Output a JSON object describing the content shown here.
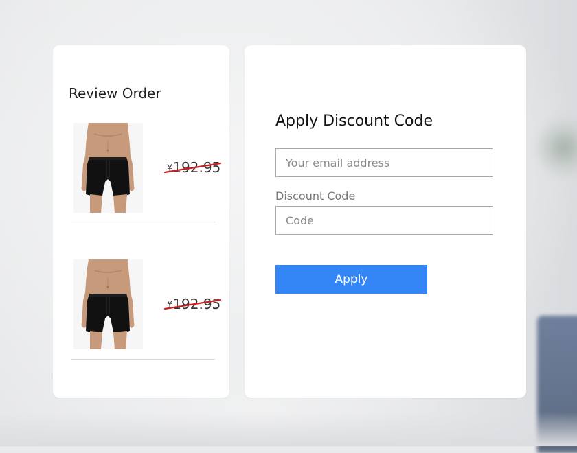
{
  "review": {
    "title": "Review Order",
    "items": [
      {
        "image": "black-boxer-briefs-photo",
        "currency": "¥",
        "price": "192.95",
        "price_strikethrough": true
      },
      {
        "image": "black-boxer-briefs-photo",
        "currency": "¥",
        "price": "192.95",
        "price_strikethrough": true
      }
    ]
  },
  "discount": {
    "title": "Apply Discount Code",
    "email_placeholder": "Your email address",
    "code_label": "Discount Code",
    "code_placeholder": "Code",
    "apply_label": "Apply"
  },
  "colors": {
    "accent": "#3486f7",
    "strike": "#cc1f1f"
  }
}
